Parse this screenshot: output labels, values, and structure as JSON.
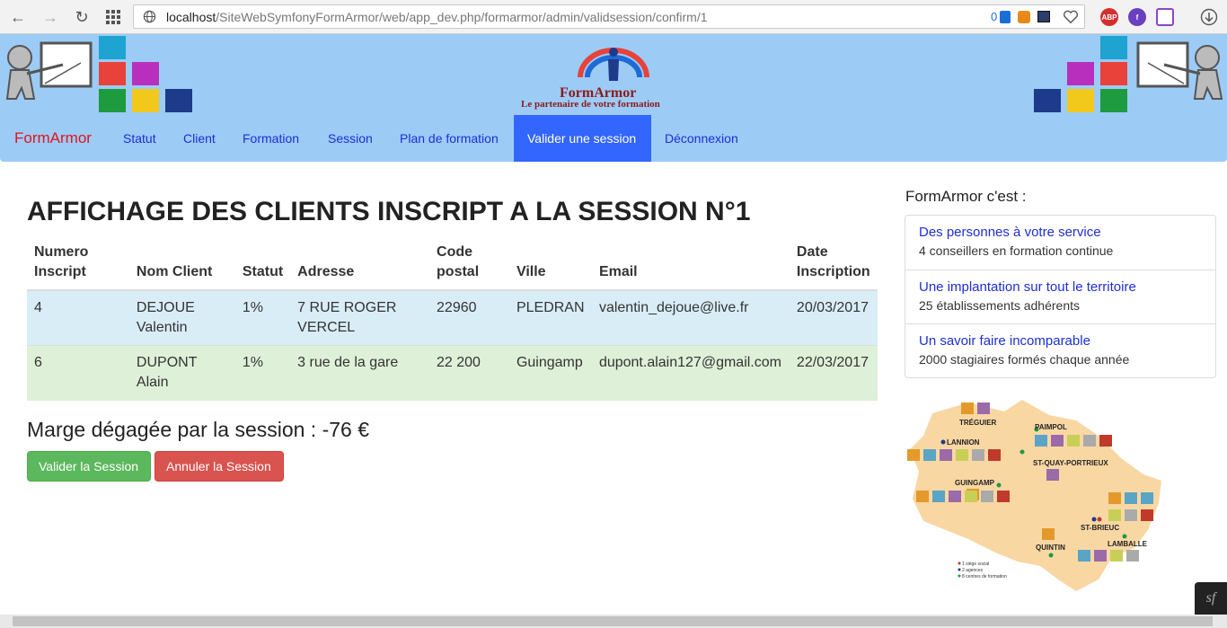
{
  "browser": {
    "url_host": "localhost",
    "url_path": "/SiteWebSymfonyFormArmor/web/app_dev.php/formarmor/admin/validsession/confirm/1",
    "tracker_count": "0",
    "ext_abp": "ABP"
  },
  "header": {
    "logo_title": "FormArmor",
    "logo_subtitle": "Le partenaire de votre formation"
  },
  "navbar": {
    "brand": "FormArmor",
    "items": [
      {
        "label": "Statut"
      },
      {
        "label": "Client"
      },
      {
        "label": "Formation"
      },
      {
        "label": "Session"
      },
      {
        "label": "Plan de formation"
      },
      {
        "label": "Valider une session",
        "active": true
      },
      {
        "label": "Déconnexion"
      }
    ]
  },
  "main": {
    "title": "AFFICHAGE DES CLIENTS INSCRIPT A LA SESSION N°1",
    "table": {
      "headers": [
        "Numero Inscript",
        "Nom Client",
        "Statut",
        "Adresse",
        "Code postal",
        "Ville",
        "Email",
        "Date Inscription"
      ],
      "rows": [
        [
          "4",
          "DEJOUE Valentin",
          "1%",
          "7 RUE ROGER VERCEL",
          "22960",
          "PLEDRAN",
          "valentin_dejoue@live.fr",
          "20/03/2017"
        ],
        [
          "6",
          "DUPONT Alain",
          "1%",
          "3 rue de la gare",
          "22 200",
          "Guingamp",
          "dupont.alain127@gmail.com",
          "22/03/2017"
        ]
      ]
    },
    "margin_text": "Marge dégagée par la session : -76 €",
    "validate_button": "Valider la Session",
    "cancel_button": "Annuler la Session"
  },
  "sidebar": {
    "title": "FormArmor c'est :",
    "items": [
      {
        "heading": "Des personnes à votre service",
        "text": "4 conseillers en formation continue"
      },
      {
        "heading": "Une implantation sur tout le territoire",
        "text": "25 établissements adhérents"
      },
      {
        "heading": "Un savoir faire incomparable",
        "text": "2000 stagiaires formés chaque année"
      }
    ],
    "map": {
      "towns": [
        "TRÉGUIER",
        "PAIMPOL",
        "LANNION",
        "ST-QUAY-PORTRIEUX",
        "GUINGAMP",
        "ST-BRIEUC",
        "QUINTIN",
        "LAMBALLE"
      ],
      "legend": [
        "1 siège social",
        "2 agences",
        "8 centres de formation"
      ]
    }
  },
  "colors": {
    "navbar_bg": "#9ccbf6",
    "active_nav": "#3366ff",
    "brand_red": "#e0141e",
    "link_blue": "#1e2ed6",
    "row_info": "#d9edf7",
    "row_success": "#dff0d8"
  },
  "icons": [
    "back-icon",
    "forward-icon",
    "reload-icon",
    "apps-grid-icon",
    "globe-icon",
    "heart-icon",
    "download-icon",
    "symfony-icon"
  ]
}
